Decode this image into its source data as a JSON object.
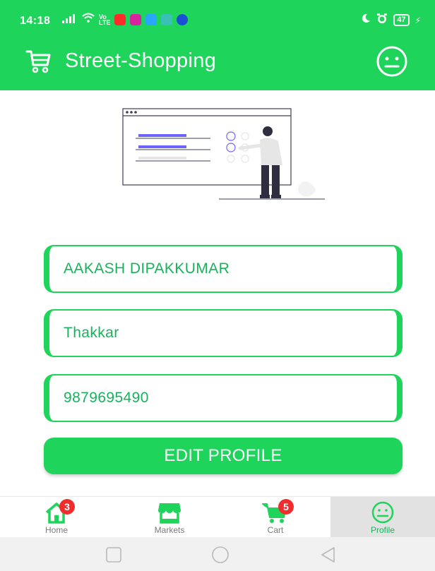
{
  "status_bar": {
    "time": "14:18",
    "battery": "47",
    "icons": [
      "signal-icon",
      "wifi-icon",
      "volte-icon",
      "app-notification-icons",
      "moon-icon",
      "alarm-icon",
      "battery-icon",
      "charging-icon"
    ]
  },
  "header": {
    "title": "Street-Shopping",
    "logo_icon": "cart-icon",
    "profile_icon": "face-icon"
  },
  "form": {
    "first_name": "AAKASH DIPAKKUMAR",
    "last_name": "Thakkar",
    "phone": "9879695490",
    "edit_button_label": "EDIT PROFILE"
  },
  "bottom_nav": {
    "items": [
      {
        "label": "Home",
        "icon": "home-icon",
        "badge": "3"
      },
      {
        "label": "Markets",
        "icon": "store-icon",
        "badge": ""
      },
      {
        "label": "Cart",
        "icon": "cart-icon",
        "badge": "5"
      },
      {
        "label": "Profile",
        "icon": "face-icon",
        "badge": ""
      }
    ],
    "active": "Profile"
  },
  "system_nav": [
    "recents-button",
    "home-button",
    "back-button"
  ],
  "colors": {
    "primary": "#1ed45a",
    "field_text": "#17b35a",
    "badge": "#f02d2d",
    "active_tab_bg": "#e2e2e2"
  }
}
